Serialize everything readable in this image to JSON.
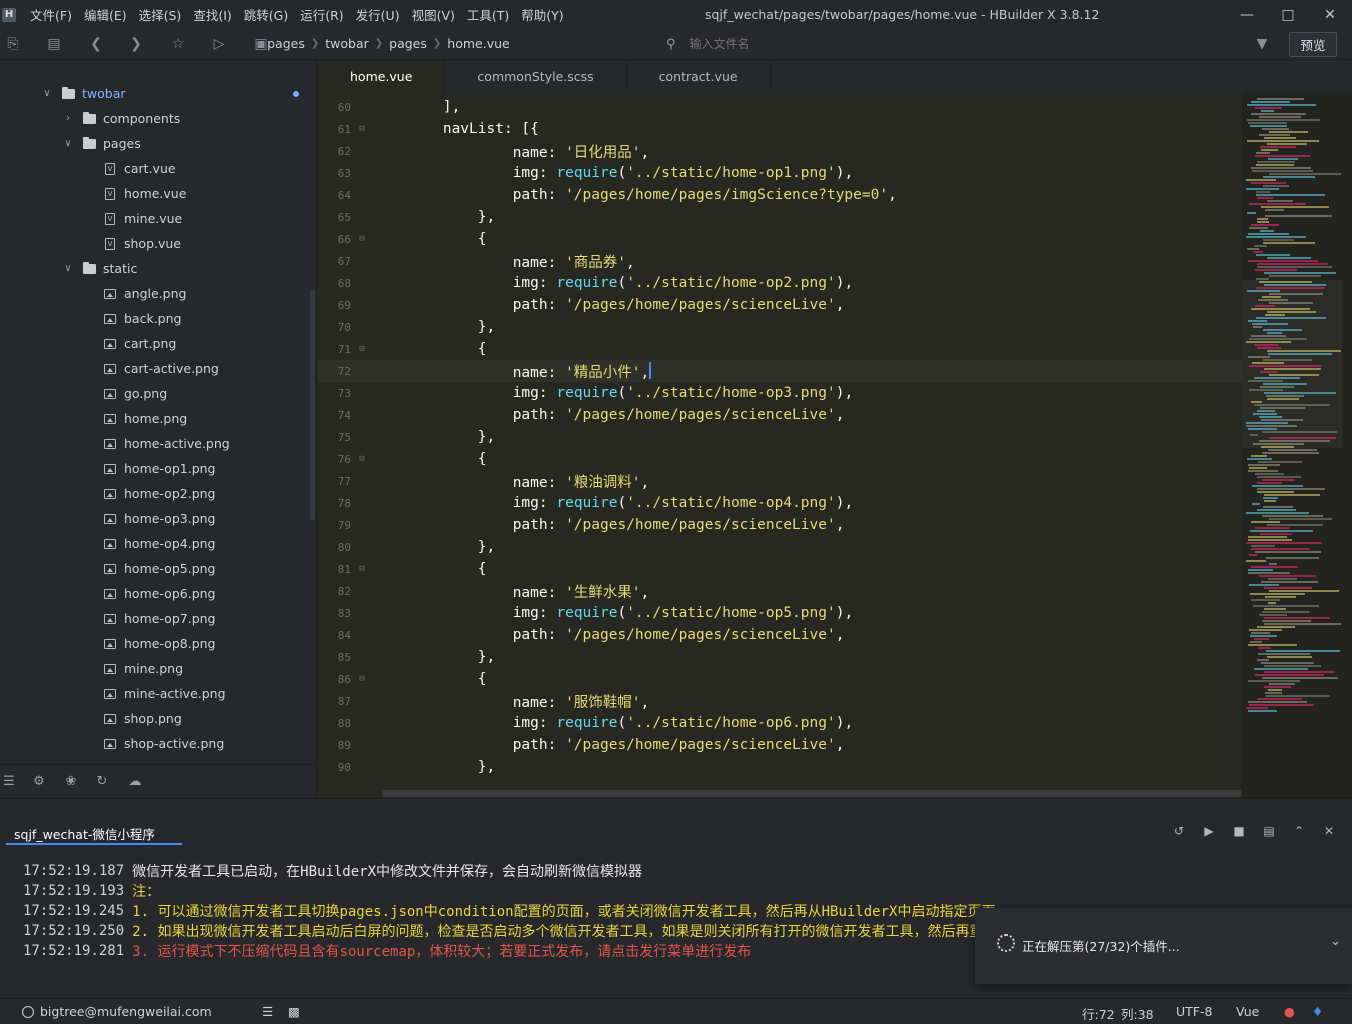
{
  "app": {
    "title": "sqjf_wechat/pages/twobar/pages/home.vue - HBuilder X 3.8.12",
    "logo": "H"
  },
  "menu": [
    "文件(F)",
    "编辑(E)",
    "选择(S)",
    "查找(I)",
    "跳转(G)",
    "运行(R)",
    "发行(U)",
    "视图(V)",
    "工具(T)",
    "帮助(Y)"
  ],
  "toolbar": {
    "breadcrumb": [
      "pages",
      "twobar",
      "pages",
      "home.vue"
    ],
    "search_placeholder": "输入文件名",
    "preview_label": "预览"
  },
  "sidebar": {
    "tree": [
      {
        "label": "twobar",
        "kind": "folder",
        "level": 0,
        "expanded": true
      },
      {
        "label": "components",
        "kind": "folder",
        "level": 1,
        "expanded": false
      },
      {
        "label": "pages",
        "kind": "folder",
        "level": 1,
        "expanded": true
      },
      {
        "label": "cart.vue",
        "kind": "file",
        "level": 2
      },
      {
        "label": "home.vue",
        "kind": "file",
        "level": 2
      },
      {
        "label": "mine.vue",
        "kind": "file",
        "level": 2
      },
      {
        "label": "shop.vue",
        "kind": "file",
        "level": 2
      },
      {
        "label": "static",
        "kind": "folder",
        "level": 1,
        "expanded": true
      },
      {
        "label": "angle.png",
        "kind": "image",
        "level": 2
      },
      {
        "label": "back.png",
        "kind": "image",
        "level": 2
      },
      {
        "label": "cart.png",
        "kind": "image",
        "level": 2
      },
      {
        "label": "cart-active.png",
        "kind": "image",
        "level": 2
      },
      {
        "label": "go.png",
        "kind": "image",
        "level": 2
      },
      {
        "label": "home.png",
        "kind": "image",
        "level": 2
      },
      {
        "label": "home-active.png",
        "kind": "image",
        "level": 2
      },
      {
        "label": "home-op1.png",
        "kind": "image",
        "level": 2
      },
      {
        "label": "home-op2.png",
        "kind": "image",
        "level": 2
      },
      {
        "label": "home-op3.png",
        "kind": "image",
        "level": 2
      },
      {
        "label": "home-op4.png",
        "kind": "image",
        "level": 2
      },
      {
        "label": "home-op5.png",
        "kind": "image",
        "level": 2
      },
      {
        "label": "home-op6.png",
        "kind": "image",
        "level": 2
      },
      {
        "label": "home-op7.png",
        "kind": "image",
        "level": 2
      },
      {
        "label": "home-op8.png",
        "kind": "image",
        "level": 2
      },
      {
        "label": "mine.png",
        "kind": "image",
        "level": 2
      },
      {
        "label": "mine-active.png",
        "kind": "image",
        "level": 2
      },
      {
        "label": "shop.png",
        "kind": "image",
        "level": 2
      },
      {
        "label": "shop-active.png",
        "kind": "image",
        "level": 2
      }
    ]
  },
  "tabs": [
    "home.vue",
    "commonStyle.scss",
    "contract.vue"
  ],
  "code_lines": [
    {
      "n": "60",
      "fold": false,
      "indent": 8,
      "tokens": [
        [
          "punc",
          "],"
        ]
      ]
    },
    {
      "n": "61",
      "fold": true,
      "indent": 8,
      "tokens": [
        [
          "key",
          "navList"
        ],
        [
          "punc",
          ": [{"
        ]
      ]
    },
    {
      "n": "62",
      "fold": false,
      "indent": 16,
      "tokens": [
        [
          "key",
          "name"
        ],
        [
          "punc",
          ": "
        ],
        [
          "str",
          "'日化用品'"
        ],
        [
          "punc",
          ","
        ]
      ]
    },
    {
      "n": "63",
      "fold": false,
      "indent": 16,
      "tokens": [
        [
          "key",
          "img"
        ],
        [
          "punc",
          ": "
        ],
        [
          "fn",
          "require"
        ],
        [
          "punc",
          "("
        ],
        [
          "str",
          "'../static/home-op1.png'"
        ],
        [
          "punc",
          "),"
        ]
      ]
    },
    {
      "n": "64",
      "fold": false,
      "indent": 16,
      "tokens": [
        [
          "key",
          "path"
        ],
        [
          "punc",
          ": "
        ],
        [
          "str",
          "'/pages/home/pages/imgScience?type=0'"
        ],
        [
          "punc",
          ","
        ]
      ]
    },
    {
      "n": "65",
      "fold": false,
      "indent": 12,
      "tokens": [
        [
          "punc",
          "},"
        ]
      ]
    },
    {
      "n": "66",
      "fold": true,
      "indent": 12,
      "tokens": [
        [
          "punc",
          "{"
        ]
      ]
    },
    {
      "n": "67",
      "fold": false,
      "indent": 16,
      "tokens": [
        [
          "key",
          "name"
        ],
        [
          "punc",
          ": "
        ],
        [
          "str",
          "'商品券'"
        ],
        [
          "punc",
          ","
        ]
      ]
    },
    {
      "n": "68",
      "fold": false,
      "indent": 16,
      "tokens": [
        [
          "key",
          "img"
        ],
        [
          "punc",
          ": "
        ],
        [
          "fn",
          "require"
        ],
        [
          "punc",
          "("
        ],
        [
          "str",
          "'../static/home-op2.png'"
        ],
        [
          "punc",
          "),"
        ]
      ]
    },
    {
      "n": "69",
      "fold": false,
      "indent": 16,
      "tokens": [
        [
          "key",
          "path"
        ],
        [
          "punc",
          ": "
        ],
        [
          "str",
          "'/pages/home/pages/scienceLive'"
        ],
        [
          "punc",
          ","
        ]
      ]
    },
    {
      "n": "70",
      "fold": false,
      "indent": 12,
      "tokens": [
        [
          "punc",
          "},"
        ]
      ]
    },
    {
      "n": "71",
      "fold": true,
      "indent": 12,
      "tokens": [
        [
          "punc",
          "{"
        ]
      ]
    },
    {
      "n": "72",
      "fold": false,
      "indent": 16,
      "current": true,
      "tokens": [
        [
          "key",
          "name"
        ],
        [
          "punc",
          ": "
        ],
        [
          "str",
          "'精品小件'"
        ],
        [
          "punc",
          ","
        ]
      ]
    },
    {
      "n": "73",
      "fold": false,
      "indent": 16,
      "tokens": [
        [
          "key",
          "img"
        ],
        [
          "punc",
          ": "
        ],
        [
          "fn",
          "require"
        ],
        [
          "punc",
          "("
        ],
        [
          "str",
          "'../static/home-op3.png'"
        ],
        [
          "punc",
          "),"
        ]
      ]
    },
    {
      "n": "74",
      "fold": false,
      "indent": 16,
      "tokens": [
        [
          "key",
          "path"
        ],
        [
          "punc",
          ": "
        ],
        [
          "str",
          "'/pages/home/pages/scienceLive'"
        ],
        [
          "punc",
          ","
        ]
      ]
    },
    {
      "n": "75",
      "fold": false,
      "indent": 12,
      "tokens": [
        [
          "punc",
          "},"
        ]
      ]
    },
    {
      "n": "76",
      "fold": true,
      "indent": 12,
      "tokens": [
        [
          "punc",
          "{"
        ]
      ]
    },
    {
      "n": "77",
      "fold": false,
      "indent": 16,
      "tokens": [
        [
          "key",
          "name"
        ],
        [
          "punc",
          ": "
        ],
        [
          "str",
          "'粮油调料'"
        ],
        [
          "punc",
          ","
        ]
      ]
    },
    {
      "n": "78",
      "fold": false,
      "indent": 16,
      "tokens": [
        [
          "key",
          "img"
        ],
        [
          "punc",
          ": "
        ],
        [
          "fn",
          "require"
        ],
        [
          "punc",
          "("
        ],
        [
          "str",
          "'../static/home-op4.png'"
        ],
        [
          "punc",
          "),"
        ]
      ]
    },
    {
      "n": "79",
      "fold": false,
      "indent": 16,
      "tokens": [
        [
          "key",
          "path"
        ],
        [
          "punc",
          ": "
        ],
        [
          "str",
          "'/pages/home/pages/scienceLive'"
        ],
        [
          "punc",
          ","
        ]
      ]
    },
    {
      "n": "80",
      "fold": false,
      "indent": 12,
      "tokens": [
        [
          "punc",
          "},"
        ]
      ]
    },
    {
      "n": "81",
      "fold": true,
      "indent": 12,
      "tokens": [
        [
          "punc",
          "{"
        ]
      ]
    },
    {
      "n": "82",
      "fold": false,
      "indent": 16,
      "tokens": [
        [
          "key",
          "name"
        ],
        [
          "punc",
          ": "
        ],
        [
          "str",
          "'生鲜水果'"
        ],
        [
          "punc",
          ","
        ]
      ]
    },
    {
      "n": "83",
      "fold": false,
      "indent": 16,
      "tokens": [
        [
          "key",
          "img"
        ],
        [
          "punc",
          ": "
        ],
        [
          "fn",
          "require"
        ],
        [
          "punc",
          "("
        ],
        [
          "str",
          "'../static/home-op5.png'"
        ],
        [
          "punc",
          "),"
        ]
      ]
    },
    {
      "n": "84",
      "fold": false,
      "indent": 16,
      "tokens": [
        [
          "key",
          "path"
        ],
        [
          "punc",
          ": "
        ],
        [
          "str",
          "'/pages/home/pages/scienceLive'"
        ],
        [
          "punc",
          ","
        ]
      ]
    },
    {
      "n": "85",
      "fold": false,
      "indent": 12,
      "tokens": [
        [
          "punc",
          "},"
        ]
      ]
    },
    {
      "n": "86",
      "fold": true,
      "indent": 12,
      "tokens": [
        [
          "punc",
          "{"
        ]
      ]
    },
    {
      "n": "87",
      "fold": false,
      "indent": 16,
      "tokens": [
        [
          "key",
          "name"
        ],
        [
          "punc",
          ": "
        ],
        [
          "str",
          "'服饰鞋帽'"
        ],
        [
          "punc",
          ","
        ]
      ]
    },
    {
      "n": "88",
      "fold": false,
      "indent": 16,
      "tokens": [
        [
          "key",
          "img"
        ],
        [
          "punc",
          ": "
        ],
        [
          "fn",
          "require"
        ],
        [
          "punc",
          "("
        ],
        [
          "str",
          "'../static/home-op6.png'"
        ],
        [
          "punc",
          "),"
        ]
      ]
    },
    {
      "n": "89",
      "fold": false,
      "indent": 16,
      "tokens": [
        [
          "key",
          "path"
        ],
        [
          "punc",
          ": "
        ],
        [
          "str",
          "'/pages/home/pages/scienceLive'"
        ],
        [
          "punc",
          ","
        ]
      ]
    },
    {
      "n": "90",
      "fold": false,
      "indent": 12,
      "tokens": [
        [
          "punc",
          "},"
        ]
      ]
    }
  ],
  "console": {
    "tab_label": "sqjf_wechat-微信小程序",
    "lines": [
      {
        "ts": "17:52:19.187",
        "msg": "微信开发者工具已启动，在HBuilderX中修改文件并保存，会自动刷新微信模拟器",
        "level": "white"
      },
      {
        "ts": "17:52:19.193",
        "msg": "注：",
        "level": "yellow"
      },
      {
        "ts": "17:52:19.245",
        "msg": "1. 可以通过微信开发者工具切换pages.json中condition配置的页面，或者关闭微信开发者工具，然后再从HBuilderX中启动指定页面",
        "level": "yellow"
      },
      {
        "ts": "17:52:19.250",
        "msg": "2. 如果出现微信开发者工具启动后白屏的问题，检查是否启动多个微信开发者工具，如果是则关闭所有打开的微信开发者工具，然后再重新运行",
        "level": "yellow"
      },
      {
        "ts": "17:52:19.281",
        "msg": "3. 运行模式下不压缩代码且含有sourcemap，体积较大；若要正式发布，请点击发行菜单进行发布",
        "level": "red"
      }
    ]
  },
  "toast": {
    "text": "正在解压第(27/32)个插件..."
  },
  "statusbar": {
    "user": "bigtree@mufengweilai.com",
    "line": "行:72",
    "col": "列:38",
    "encoding": "UTF-8",
    "language": "Vue"
  },
  "colors": {
    "accent": "#3f8cff",
    "string": "#e6db74",
    "function": "#66d9ef",
    "warning": "#e8d63a",
    "error": "#e0564e"
  }
}
